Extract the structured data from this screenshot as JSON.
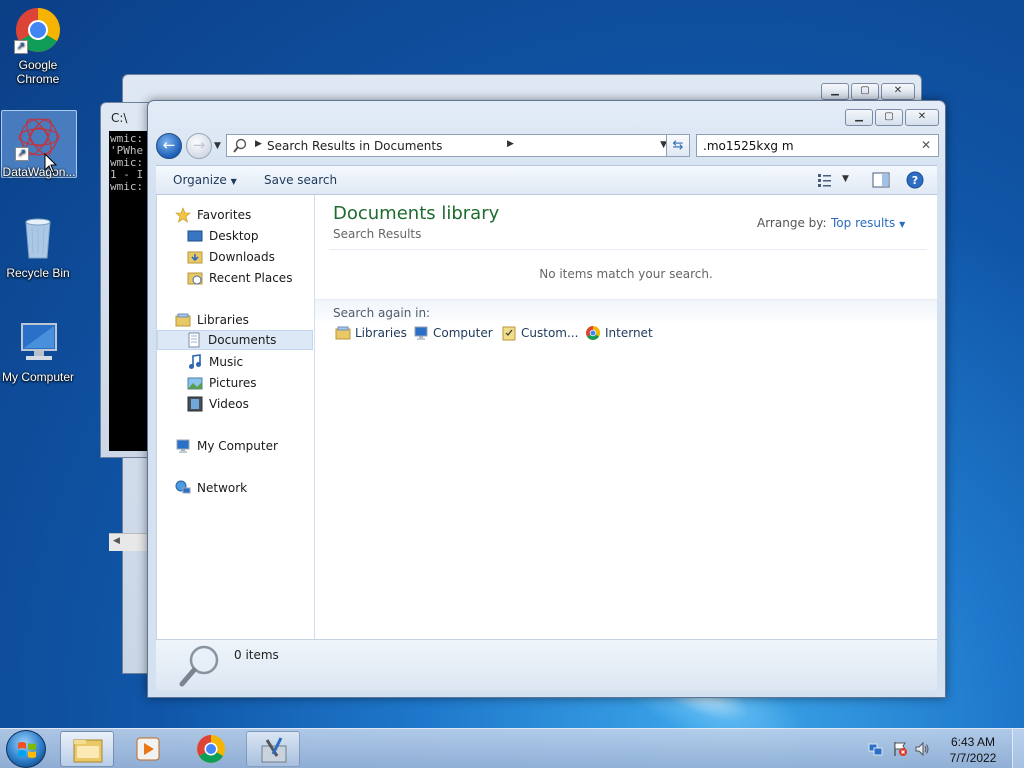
{
  "desktop": {
    "icons": [
      {
        "label": "Google\nChrome"
      },
      {
        "label": "DataWagon..."
      },
      {
        "label": "Recycle Bin"
      },
      {
        "label": "My Computer"
      }
    ]
  },
  "cmd": {
    "title": "C:\\",
    "lines": "wmic:\n'PWhe\nwmic:\n1 - I\nwmic:"
  },
  "explorer": {
    "breadcrumb": "Search Results in Documents",
    "search_value": ".mo1525kxg m",
    "toolbar": {
      "organize": "Organize",
      "save_search": "Save search"
    },
    "nav": {
      "favorites": "Favorites",
      "desktop": "Desktop",
      "downloads": "Downloads",
      "recent": "Recent Places",
      "libraries": "Libraries",
      "documents": "Documents",
      "music": "Music",
      "pictures": "Pictures",
      "videos": "Videos",
      "computer": "My Computer",
      "network": "Network"
    },
    "results": {
      "title": "Documents library",
      "subtitle": "Search Results",
      "arrange_label": "Arrange by:",
      "arrange_value": "Top results",
      "empty_message": "No items match your search.",
      "search_again_label": "Search again in:",
      "search_again": {
        "libraries": "Libraries",
        "computer": "Computer",
        "custom": "Custom...",
        "internet": "Internet"
      }
    },
    "details": {
      "count": "0 items"
    }
  },
  "taskbar": {
    "time": "6:43 AM",
    "date": "7/7/2022"
  },
  "colors": {
    "library_title": "#1e6b2e",
    "link_blue": "#2b6cc1",
    "selection": "#dde8f6"
  }
}
